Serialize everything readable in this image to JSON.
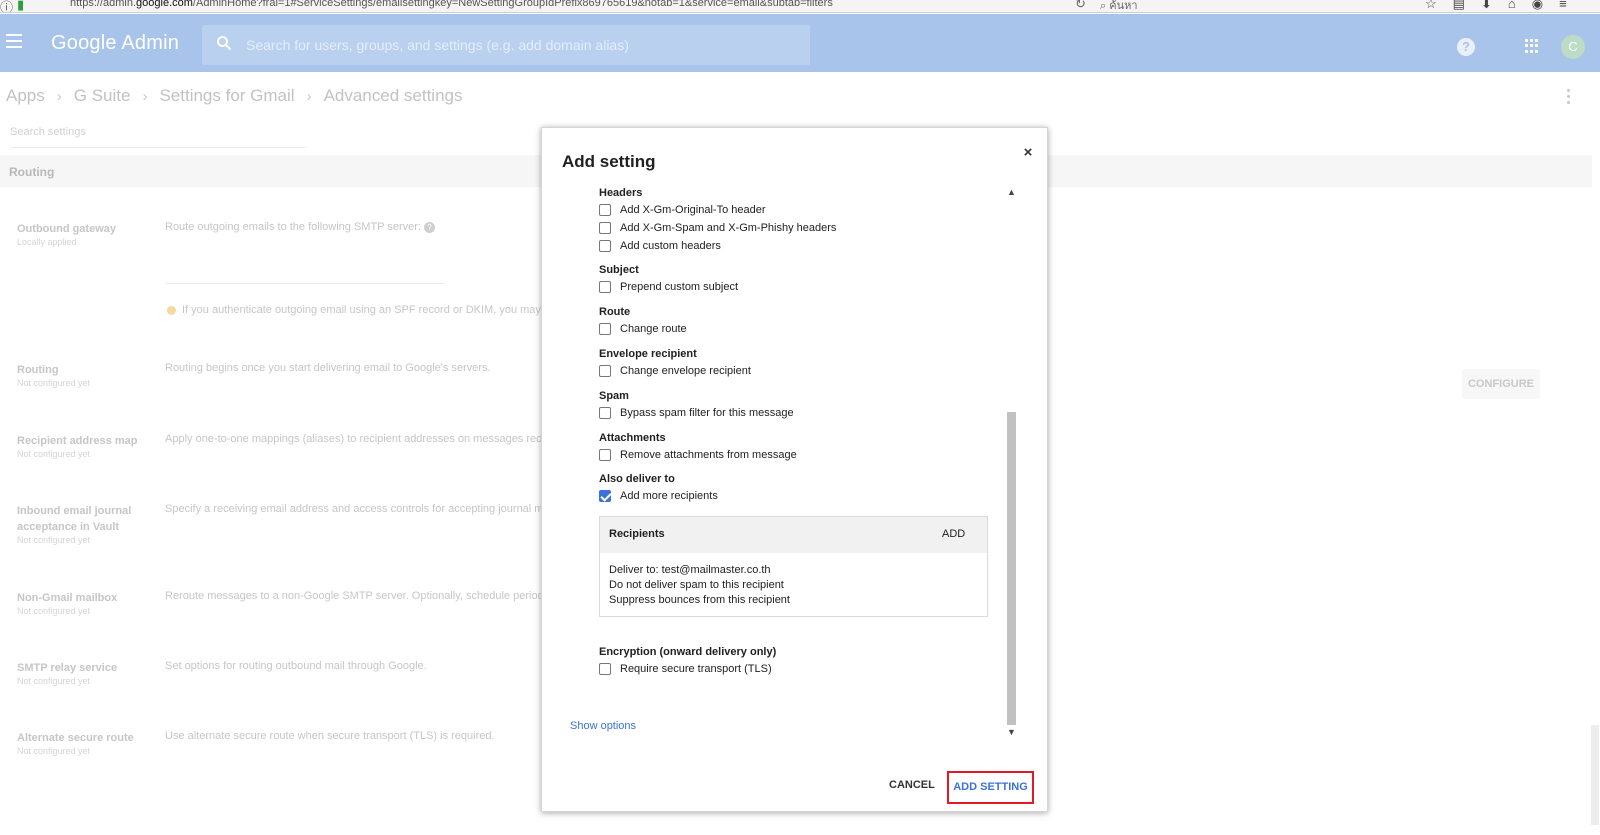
{
  "browser": {
    "url_prefix": "https://admin.",
    "url_domain": "google.com",
    "url_suffix": "/AdminHome?fral=1#ServiceSettings/emailsettingkey=NewSettingGroupIdPrefix869765619&notab=1&service=email&subtab=filters",
    "search_placeholder": "ค้นหา"
  },
  "header": {
    "logo": "Google Admin",
    "search_placeholder": "Search for users, groups, and settings (e.g. add domain alias)",
    "avatar_initial": "C",
    "help_glyph": "?"
  },
  "breadcrumb": [
    "Apps",
    "G Suite",
    "Settings for Gmail",
    "Advanced settings"
  ],
  "settings_search_placeholder": "Search settings",
  "section_title": "Routing",
  "background_rows": [
    {
      "title": "Outbound gateway",
      "sub": "Locally applied",
      "desc": "Route outgoing emails to the following SMTP server:"
    },
    {
      "title": "Routing",
      "sub": "Not configured yet",
      "desc": "Routing begins once you start delivering email to Google's servers."
    },
    {
      "title": "Recipient address map",
      "sub": "Not configured yet",
      "desc": "Apply one-to-one mappings (aliases) to recipient addresses on messages rec"
    },
    {
      "title": "Inbound email journal acceptance in Vault",
      "sub": "Not configured yet",
      "desc": "Specify a receiving email address and access controls for accepting journal m"
    },
    {
      "title": "Non-Gmail mailbox",
      "sub": "Not configured yet",
      "desc": "Reroute messages to a non-Google SMTP server. Optionally, schedule periodic"
    },
    {
      "title": "SMTP relay service",
      "sub": "Not configured yet",
      "desc": "Set options for routing outbound mail through Google."
    },
    {
      "title": "Alternate secure route",
      "sub": "Not configured yet",
      "desc": "Use alternate secure route when secure transport (TLS) is required."
    }
  ],
  "gateway_note": "If you authenticate outgoing email using an SPF record or DKIM, you may",
  "configure_label": "CONFIGURE",
  "modal": {
    "title": "Add setting",
    "close_glyph": "×",
    "groups": {
      "headers": "Headers",
      "subject": "Subject",
      "route": "Route",
      "envelope": "Envelope recipient",
      "spam": "Spam",
      "attachments": "Attachments",
      "also_deliver": "Also deliver to",
      "encryption": "Encryption (onward delivery only)"
    },
    "options": {
      "x_gm_original_to": {
        "label": "Add X-Gm-Original-To header",
        "checked": false
      },
      "x_gm_spam": {
        "label": "Add X-Gm-Spam and X-Gm-Phishy headers",
        "checked": false
      },
      "custom_headers": {
        "label": "Add custom headers",
        "checked": false
      },
      "custom_subject": {
        "label": "Prepend custom subject",
        "checked": false
      },
      "change_route": {
        "label": "Change route",
        "checked": false
      },
      "change_envelope": {
        "label": "Change envelope recipient",
        "checked": false
      },
      "bypass_spam": {
        "label": "Bypass spam filter for this message",
        "checked": false
      },
      "remove_attachments": {
        "label": "Remove attachments from message",
        "checked": false
      },
      "more_recipients": {
        "label": "Add more recipients",
        "checked": true
      },
      "require_tls": {
        "label": "Require secure transport (TLS)",
        "checked": false
      }
    },
    "recipients": {
      "title": "Recipients",
      "add_label": "ADD",
      "deliver_to": "Deliver to: test@mailmaster.co.th",
      "spam_note": "Do not deliver spam to this recipient",
      "bounce_note": "Suppress bounces from this recipient"
    },
    "show_options": "Show options",
    "cancel_label": "CANCEL",
    "add_label": "ADD SETTING"
  }
}
